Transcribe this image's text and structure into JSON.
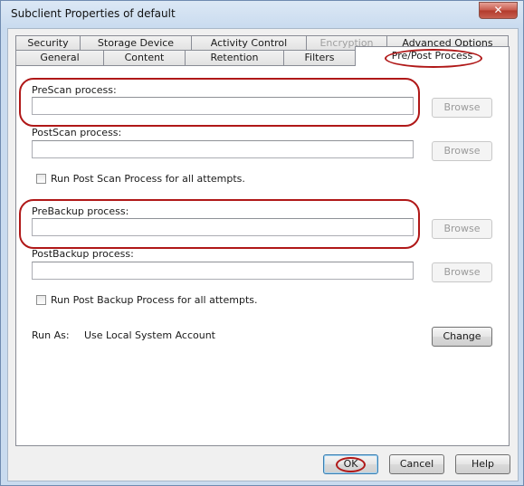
{
  "window": {
    "title": "Subclient Properties of default",
    "close_glyph": "✕"
  },
  "tabs_row1": [
    {
      "label": "Security",
      "disabled": false
    },
    {
      "label": "Storage Device",
      "disabled": false
    },
    {
      "label": "Activity Control",
      "disabled": false
    },
    {
      "label": "Encryption",
      "disabled": true
    },
    {
      "label": "Advanced Options",
      "disabled": false
    }
  ],
  "tabs_row2": [
    {
      "label": "General"
    },
    {
      "label": "Content"
    },
    {
      "label": "Retention"
    },
    {
      "label": "Filters"
    },
    {
      "label": "Pre/Post Process",
      "active": true
    }
  ],
  "panel": {
    "prescan": {
      "label": "PreScan process:",
      "value": "",
      "browse": "Browse"
    },
    "postscan": {
      "label": "PostScan process:",
      "value": "",
      "browse": "Browse"
    },
    "postscan_all": {
      "label": "Run Post Scan Process for all attempts.",
      "checked": false
    },
    "prebackup": {
      "label": "PreBackup process:",
      "value": "",
      "browse": "Browse"
    },
    "postbackup": {
      "label": "PostBackup process:",
      "value": "",
      "browse": "Browse"
    },
    "postbackup_all": {
      "label": "Run Post Backup Process for all attempts.",
      "checked": false
    },
    "run_as": {
      "label": "Run As:",
      "value": "Use Local System Account",
      "change": "Change"
    }
  },
  "footer": {
    "ok": "OK",
    "cancel": "Cancel",
    "help": "Help"
  },
  "colors": {
    "annotation": "#b01818"
  }
}
